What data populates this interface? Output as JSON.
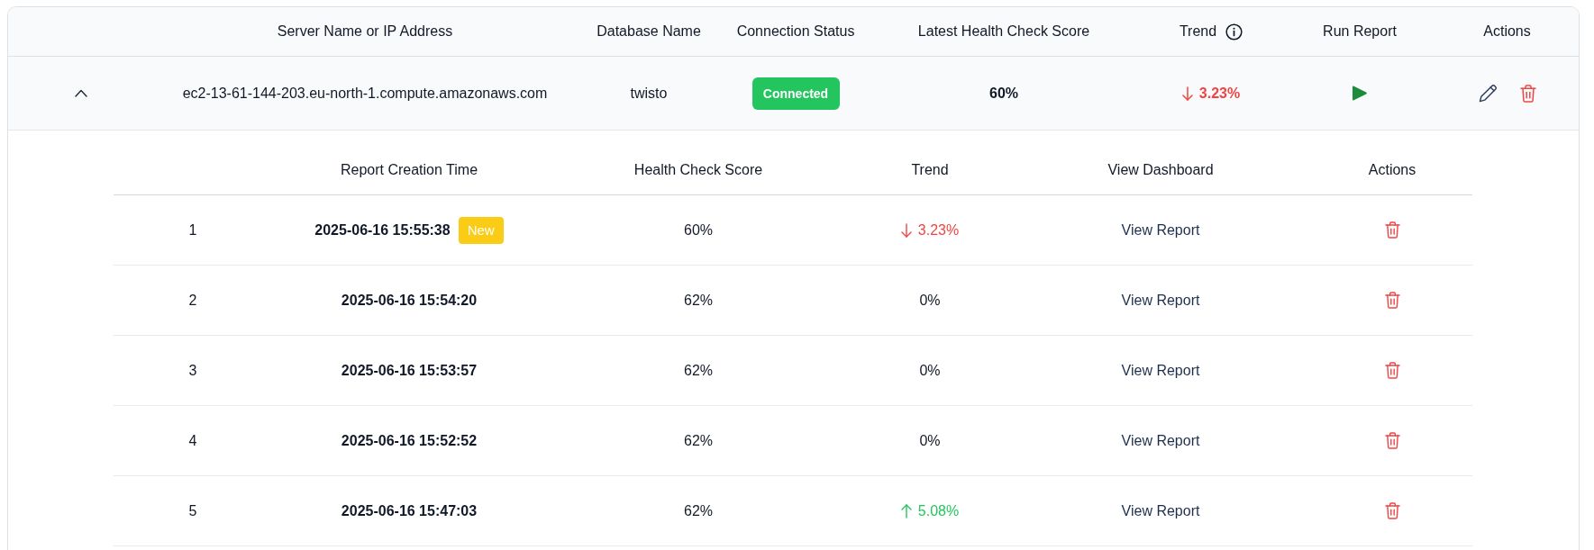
{
  "table": {
    "columns": [
      {
        "label": "Server Name or IP Address",
        "info": false
      },
      {
        "label": "Database Name",
        "info": false
      },
      {
        "label": "Connection Status",
        "info": false
      },
      {
        "label": "Latest Health Check Score",
        "info": false
      },
      {
        "label": "Trend",
        "info": true
      },
      {
        "label": "Run Report",
        "info": false
      },
      {
        "label": "Actions",
        "info": false
      }
    ],
    "rows": [
      {
        "expanded": true,
        "server": "ec2-13-61-144-203.eu-north-1.compute.amazonaws.com",
        "database": "twisto",
        "status": {
          "label": "Connected",
          "connected": true
        },
        "score": "60%",
        "trend": {
          "kind": "down",
          "value": "3.23%"
        },
        "reports": {
          "columns": [
            "Report Creation Time",
            "Health Check Score",
            "Trend",
            "View Dashboard",
            "Actions"
          ],
          "rows": [
            {
              "index": "1",
              "created": "2025-06-16 15:55:38",
              "badge": "New",
              "score": "60%",
              "trend": {
                "kind": "down",
                "value": "3.23%"
              },
              "link": "View Report"
            },
            {
              "index": "2",
              "created": "2025-06-16 15:54:20",
              "score": "62%",
              "trend": {
                "kind": "flat",
                "value": "0%"
              },
              "link": "View Report"
            },
            {
              "index": "3",
              "created": "2025-06-16 15:53:57",
              "score": "62%",
              "trend": {
                "kind": "flat",
                "value": "0%"
              },
              "link": "View Report"
            },
            {
              "index": "4",
              "created": "2025-06-16 15:52:52",
              "score": "62%",
              "trend": {
                "kind": "flat",
                "value": "0%"
              },
              "link": "View Report"
            },
            {
              "index": "5",
              "created": "2025-06-16 15:47:03",
              "score": "62%",
              "trend": {
                "kind": "up",
                "value": "5.08%"
              },
              "link": "View Report"
            }
          ]
        }
      }
    ]
  }
}
